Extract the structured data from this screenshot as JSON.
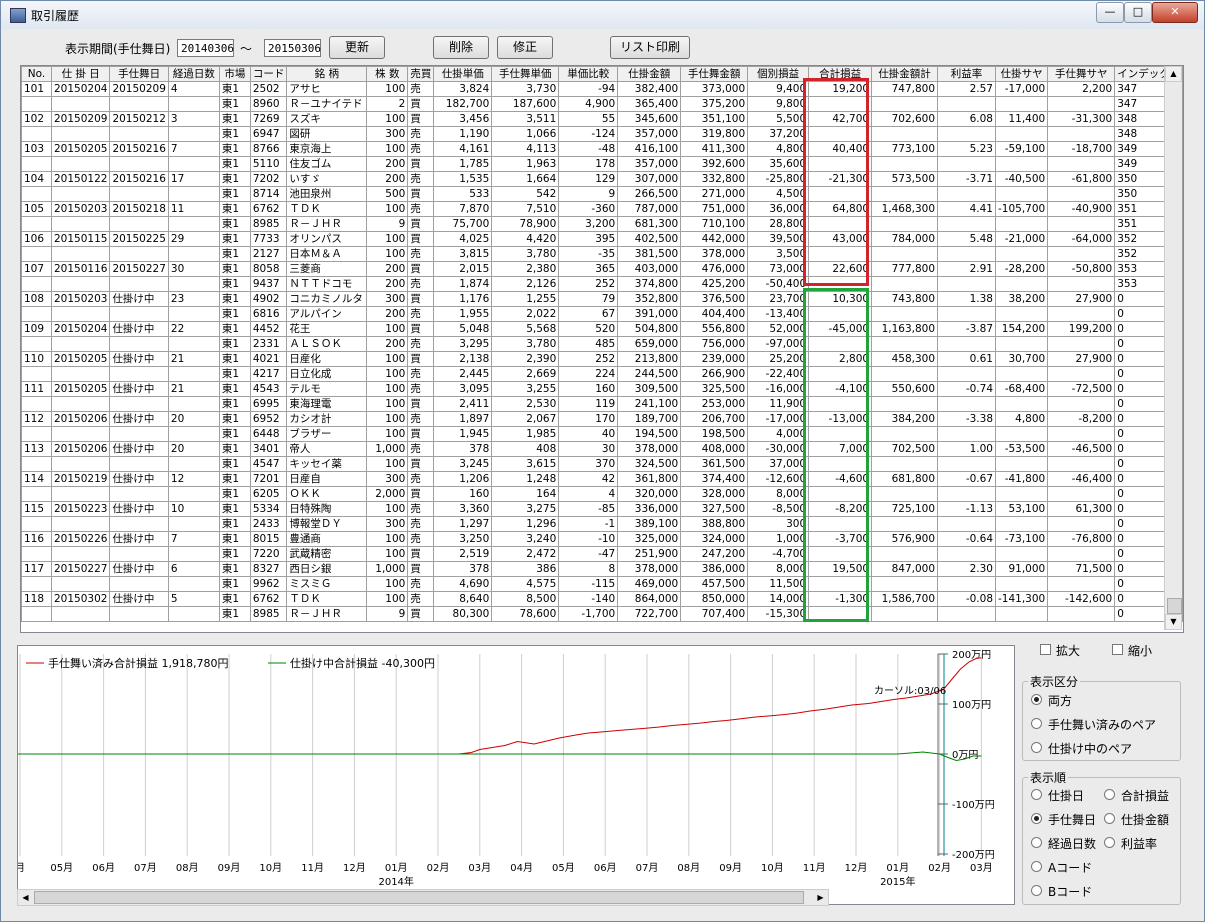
{
  "window": {
    "title": "取引履歴",
    "btn_min": "—",
    "btn_max": "□",
    "btn_close": "✕"
  },
  "toolbar": {
    "period_label": "表示期間(手仕舞日)",
    "date_from": "20140306",
    "tilde": "～",
    "date_to": "20150306",
    "refresh": "更新",
    "delete": "削除",
    "edit": "修正",
    "print": "リスト印刷"
  },
  "grid": {
    "columns": [
      "No.",
      "仕 掛 日",
      "手仕舞日",
      "経過日数",
      "市場",
      "コード",
      "銘 柄",
      "株 数",
      "売買",
      "仕掛単価",
      "手仕舞単価",
      "単価比較",
      "仕掛金額",
      "手仕舞金額",
      "個別損益",
      "合計損益",
      "仕掛金額計",
      "利益率",
      "仕掛サヤ",
      "手仕舞サヤ",
      "インデックス"
    ],
    "rows": [
      [
        "101",
        "20150204",
        "20150209",
        "4",
        "東1",
        "2502",
        "アサヒ",
        "100",
        "売",
        "3,824",
        "3,730",
        "-94",
        "382,400",
        "373,000",
        "9,400",
        "19,200",
        "747,800",
        "2.57",
        "-17,000",
        "2,200",
        "347"
      ],
      [
        "",
        "",
        "",
        "",
        "東1",
        "8960",
        "Ｒ－ユナイテド",
        "2",
        "買",
        "182,700",
        "187,600",
        "4,900",
        "365,400",
        "375,200",
        "9,800",
        "",
        "",
        "",
        "",
        "",
        "347"
      ],
      [
        "102",
        "20150209",
        "20150212",
        "3",
        "東1",
        "7269",
        "スズキ",
        "100",
        "買",
        "3,456",
        "3,511",
        "55",
        "345,600",
        "351,100",
        "5,500",
        "42,700",
        "702,600",
        "6.08",
        "11,400",
        "-31,300",
        "348"
      ],
      [
        "",
        "",
        "",
        "",
        "東1",
        "6947",
        "図研",
        "300",
        "売",
        "1,190",
        "1,066",
        "-124",
        "357,000",
        "319,800",
        "37,200",
        "",
        "",
        "",
        "",
        "",
        "348"
      ],
      [
        "103",
        "20150205",
        "20150216",
        "7",
        "東1",
        "8766",
        "東京海上",
        "100",
        "売",
        "4,161",
        "4,113",
        "-48",
        "416,100",
        "411,300",
        "4,800",
        "40,400",
        "773,100",
        "5.23",
        "-59,100",
        "-18,700",
        "349"
      ],
      [
        "",
        "",
        "",
        "",
        "東1",
        "5110",
        "住友ゴム",
        "200",
        "買",
        "1,785",
        "1,963",
        "178",
        "357,000",
        "392,600",
        "35,600",
        "",
        "",
        "",
        "",
        "",
        "349"
      ],
      [
        "104",
        "20150122",
        "20150216",
        "17",
        "東1",
        "7202",
        "いすゞ",
        "200",
        "売",
        "1,535",
        "1,664",
        "129",
        "307,000",
        "332,800",
        "-25,800",
        "-21,300",
        "573,500",
        "-3.71",
        "-40,500",
        "-61,800",
        "350"
      ],
      [
        "",
        "",
        "",
        "",
        "東1",
        "8714",
        "池田泉州",
        "500",
        "買",
        "533",
        "542",
        "9",
        "266,500",
        "271,000",
        "4,500",
        "",
        "",
        "",
        "",
        "",
        "350"
      ],
      [
        "105",
        "20150203",
        "20150218",
        "11",
        "東1",
        "6762",
        "ＴＤＫ",
        "100",
        "売",
        "7,870",
        "7,510",
        "-360",
        "787,000",
        "751,000",
        "36,000",
        "64,800",
        "1,468,300",
        "4.41",
        "-105,700",
        "-40,900",
        "351"
      ],
      [
        "",
        "",
        "",
        "",
        "東1",
        "8985",
        "Ｒ－ＪＨＲ",
        "9",
        "買",
        "75,700",
        "78,900",
        "3,200",
        "681,300",
        "710,100",
        "28,800",
        "",
        "",
        "",
        "",
        "",
        "351"
      ],
      [
        "106",
        "20150115",
        "20150225",
        "29",
        "東1",
        "7733",
        "オリンパス",
        "100",
        "買",
        "4,025",
        "4,420",
        "395",
        "402,500",
        "442,000",
        "39,500",
        "43,000",
        "784,000",
        "5.48",
        "-21,000",
        "-64,000",
        "352"
      ],
      [
        "",
        "",
        "",
        "",
        "東1",
        "2127",
        "日本Ｍ＆Ａ",
        "100",
        "売",
        "3,815",
        "3,780",
        "-35",
        "381,500",
        "378,000",
        "3,500",
        "",
        "",
        "",
        "",
        "",
        "352"
      ],
      [
        "107",
        "20150116",
        "20150227",
        "30",
        "東1",
        "8058",
        "三菱商",
        "200",
        "買",
        "2,015",
        "2,380",
        "365",
        "403,000",
        "476,000",
        "73,000",
        "22,600",
        "777,800",
        "2.91",
        "-28,200",
        "-50,800",
        "353"
      ],
      [
        "",
        "",
        "",
        "",
        "東1",
        "9437",
        "ＮＴＴドコモ",
        "200",
        "売",
        "1,874",
        "2,126",
        "252",
        "374,800",
        "425,200",
        "-50,400",
        "",
        "",
        "",
        "",
        "",
        "353"
      ],
      [
        "108",
        "20150203",
        "仕掛け中",
        "23",
        "東1",
        "4902",
        "コニカミノルタ",
        "300",
        "買",
        "1,176",
        "1,255",
        "79",
        "352,800",
        "376,500",
        "23,700",
        "10,300",
        "743,800",
        "1.38",
        "38,200",
        "27,900",
        "0"
      ],
      [
        "",
        "",
        "",
        "",
        "東1",
        "6816",
        "アルパイン",
        "200",
        "売",
        "1,955",
        "2,022",
        "67",
        "391,000",
        "404,400",
        "-13,400",
        "",
        "",
        "",
        "",
        "",
        "0"
      ],
      [
        "109",
        "20150204",
        "仕掛け中",
        "22",
        "東1",
        "4452",
        "花王",
        "100",
        "買",
        "5,048",
        "5,568",
        "520",
        "504,800",
        "556,800",
        "52,000",
        "-45,000",
        "1,163,800",
        "-3.87",
        "154,200",
        "199,200",
        "0"
      ],
      [
        "",
        "",
        "",
        "",
        "東1",
        "2331",
        "ＡＬＳＯＫ",
        "200",
        "売",
        "3,295",
        "3,780",
        "485",
        "659,000",
        "756,000",
        "-97,000",
        "",
        "",
        "",
        "",
        "",
        "0"
      ],
      [
        "110",
        "20150205",
        "仕掛け中",
        "21",
        "東1",
        "4021",
        "日産化",
        "100",
        "買",
        "2,138",
        "2,390",
        "252",
        "213,800",
        "239,000",
        "25,200",
        "2,800",
        "458,300",
        "0.61",
        "30,700",
        "27,900",
        "0"
      ],
      [
        "",
        "",
        "",
        "",
        "東1",
        "4217",
        "日立化成",
        "100",
        "売",
        "2,445",
        "2,669",
        "224",
        "244,500",
        "266,900",
        "-22,400",
        "",
        "",
        "",
        "",
        "",
        "0"
      ],
      [
        "111",
        "20150205",
        "仕掛け中",
        "21",
        "東1",
        "4543",
        "テルモ",
        "100",
        "売",
        "3,095",
        "3,255",
        "160",
        "309,500",
        "325,500",
        "-16,000",
        "-4,100",
        "550,600",
        "-0.74",
        "-68,400",
        "-72,500",
        "0"
      ],
      [
        "",
        "",
        "",
        "",
        "東1",
        "6995",
        "東海理電",
        "100",
        "買",
        "2,411",
        "2,530",
        "119",
        "241,100",
        "253,000",
        "11,900",
        "",
        "",
        "",
        "",
        "",
        "0"
      ],
      [
        "112",
        "20150206",
        "仕掛け中",
        "20",
        "東1",
        "6952",
        "カシオ計",
        "100",
        "売",
        "1,897",
        "2,067",
        "170",
        "189,700",
        "206,700",
        "-17,000",
        "-13,000",
        "384,200",
        "-3.38",
        "4,800",
        "-8,200",
        "0"
      ],
      [
        "",
        "",
        "",
        "",
        "東1",
        "6448",
        "ブラザー",
        "100",
        "買",
        "1,945",
        "1,985",
        "40",
        "194,500",
        "198,500",
        "4,000",
        "",
        "",
        "",
        "",
        "",
        "0"
      ],
      [
        "113",
        "20150206",
        "仕掛け中",
        "20",
        "東1",
        "3401",
        "帝人",
        "1,000",
        "売",
        "378",
        "408",
        "30",
        "378,000",
        "408,000",
        "-30,000",
        "7,000",
        "702,500",
        "1.00",
        "-53,500",
        "-46,500",
        "0"
      ],
      [
        "",
        "",
        "",
        "",
        "東1",
        "4547",
        "キッセイ薬",
        "100",
        "買",
        "3,245",
        "3,615",
        "370",
        "324,500",
        "361,500",
        "37,000",
        "",
        "",
        "",
        "",
        "",
        "0"
      ],
      [
        "114",
        "20150219",
        "仕掛け中",
        "12",
        "東1",
        "7201",
        "日産自",
        "300",
        "売",
        "1,206",
        "1,248",
        "42",
        "361,800",
        "374,400",
        "-12,600",
        "-4,600",
        "681,800",
        "-0.67",
        "-41,800",
        "-46,400",
        "0"
      ],
      [
        "",
        "",
        "",
        "",
        "東1",
        "6205",
        "ＯＫＫ",
        "2,000",
        "買",
        "160",
        "164",
        "4",
        "320,000",
        "328,000",
        "8,000",
        "",
        "",
        "",
        "",
        "",
        "0"
      ],
      [
        "115",
        "20150223",
        "仕掛け中",
        "10",
        "東1",
        "5334",
        "日特殊陶",
        "100",
        "売",
        "3,360",
        "3,275",
        "-85",
        "336,000",
        "327,500",
        "-8,500",
        "-8,200",
        "725,100",
        "-1.13",
        "53,100",
        "61,300",
        "0"
      ],
      [
        "",
        "",
        "",
        "",
        "東1",
        "2433",
        "博報堂ＤＹ",
        "300",
        "売",
        "1,297",
        "1,296",
        "-1",
        "389,100",
        "388,800",
        "300",
        "",
        "",
        "",
        "",
        "",
        "0"
      ],
      [
        "116",
        "20150226",
        "仕掛け中",
        "7",
        "東1",
        "8015",
        "豊通商",
        "100",
        "売",
        "3,250",
        "3,240",
        "-10",
        "325,000",
        "324,000",
        "1,000",
        "-3,700",
        "576,900",
        "-0.64",
        "-73,100",
        "-76,800",
        "0"
      ],
      [
        "",
        "",
        "",
        "",
        "東1",
        "7220",
        "武蔵精密",
        "100",
        "買",
        "2,519",
        "2,472",
        "-47",
        "251,900",
        "247,200",
        "-4,700",
        "",
        "",
        "",
        "",
        "",
        "0"
      ],
      [
        "117",
        "20150227",
        "仕掛け中",
        "6",
        "東1",
        "8327",
        "西日シ銀",
        "1,000",
        "買",
        "378",
        "386",
        "8",
        "378,000",
        "386,000",
        "8,000",
        "19,500",
        "847,000",
        "2.30",
        "91,000",
        "71,500",
        "0"
      ],
      [
        "",
        "",
        "",
        "",
        "東1",
        "9962",
        "ミスミＧ",
        "100",
        "売",
        "4,690",
        "4,575",
        "-115",
        "469,000",
        "457,500",
        "11,500",
        "",
        "",
        "",
        "",
        "",
        "0"
      ],
      [
        "118",
        "20150302",
        "仕掛け中",
        "5",
        "東1",
        "6762",
        "ＴＤＫ",
        "100",
        "売",
        "8,640",
        "8,500",
        "-140",
        "864,000",
        "850,000",
        "14,000",
        "-1,300",
        "1,586,700",
        "-0.08",
        "-141,300",
        "-142,600",
        "0"
      ],
      [
        "",
        "",
        "",
        "",
        "東1",
        "8985",
        "Ｒ－ＪＨＲ",
        "9",
        "買",
        "80,300",
        "78,600",
        "-1,700",
        "722,700",
        "707,400",
        "-15,300",
        "",
        "",
        "",
        "",
        "",
        "0"
      ]
    ]
  },
  "highlight_colors": {
    "closed": "#d0232a",
    "open": "#1fa33a"
  },
  "chart_data": {
    "type": "line",
    "legend": [
      {
        "name": "手仕舞い済み合計損益",
        "value": "1,918,780円",
        "color": "#cc0000"
      },
      {
        "name": "仕掛け中合計損益",
        "value": "-40,300円",
        "color": "#008000"
      }
    ],
    "cursor_label": "カーソル:03/06",
    "y_ticks": [
      "200万円",
      "100万円",
      "0万円",
      "-100万円",
      "-200万円"
    ],
    "ylim": [
      -200,
      200
    ],
    "x_ticks": [
      "月",
      "05月",
      "06月",
      "07月",
      "08月",
      "09月",
      "10月",
      "11月",
      "12月",
      "01月",
      "02月",
      "03月",
      "04月",
      "05月",
      "06月",
      "07月",
      "08月",
      "09月",
      "10月",
      "11月",
      "12月",
      "01月",
      "02月",
      "03月"
    ],
    "x_years": [
      "2014年",
      "2015年"
    ],
    "series": [
      {
        "name": "手仕舞い済み合計損益",
        "points": [
          [
            10.5,
            0
          ],
          [
            10.8,
            3
          ],
          [
            11.0,
            9
          ],
          [
            11.3,
            13
          ],
          [
            11.6,
            17
          ],
          [
            11.9,
            25
          ],
          [
            12.3,
            20
          ],
          [
            12.6,
            26
          ],
          [
            12.9,
            32
          ],
          [
            13.3,
            38
          ],
          [
            13.6,
            42
          ],
          [
            13.9,
            44
          ],
          [
            14.3,
            47
          ],
          [
            14.6,
            49
          ],
          [
            14.9,
            51
          ],
          [
            15.3,
            54
          ],
          [
            15.6,
            57
          ],
          [
            15.9,
            59
          ],
          [
            16.3,
            62
          ],
          [
            16.6,
            65
          ],
          [
            16.9,
            67
          ],
          [
            17.3,
            71
          ],
          [
            17.6,
            74
          ],
          [
            17.9,
            76
          ],
          [
            18.3,
            79
          ],
          [
            18.6,
            82
          ],
          [
            18.9,
            86
          ],
          [
            19.3,
            90
          ],
          [
            19.6,
            94
          ],
          [
            19.9,
            98
          ],
          [
            20.3,
            101
          ],
          [
            20.6,
            105
          ],
          [
            20.9,
            109
          ],
          [
            21.2,
            112
          ],
          [
            21.5,
            116
          ],
          [
            21.8,
            120
          ],
          [
            22.1,
            130
          ],
          [
            22.3,
            150
          ],
          [
            22.5,
            170
          ],
          [
            22.7,
            184
          ],
          [
            22.9,
            192
          ],
          [
            23.0,
            192
          ]
        ]
      },
      {
        "name": "仕掛け中合計損益",
        "points": [
          [
            -0.3,
            0
          ],
          [
            21.0,
            0
          ],
          [
            21.3,
            2
          ],
          [
            21.6,
            4
          ],
          [
            21.8,
            2
          ],
          [
            22.0,
            0
          ],
          [
            22.2,
            -7
          ],
          [
            22.4,
            -13
          ],
          [
            22.6,
            -10
          ],
          [
            22.8,
            -4
          ],
          [
            23.0,
            -4
          ]
        ]
      }
    ]
  },
  "side": {
    "expand": "拡大",
    "shrink": "縮小",
    "display_group_title": "表示区分",
    "display_options": [
      "両方",
      "手仕舞い済みのペア",
      "仕掛け中のペア"
    ],
    "display_selected": 0,
    "order_group_title": "表示順",
    "order_left": [
      "仕掛日",
      "手仕舞日",
      "経過日数",
      "Aコード",
      "Bコード"
    ],
    "order_right": [
      "合計損益",
      "仕掛金額",
      "利益率"
    ],
    "order_selected": "手仕舞日"
  }
}
